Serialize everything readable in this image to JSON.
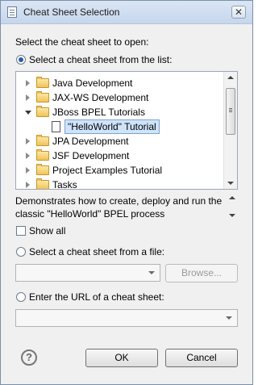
{
  "window": {
    "title": "Cheat Sheet Selection",
    "close_glyph": "✕"
  },
  "intro": "Select the cheat sheet to open:",
  "option_list": {
    "label": "Select a cheat sheet from the list:",
    "selected": true
  },
  "tree": {
    "items": [
      {
        "label": "Java Development",
        "expanded": false
      },
      {
        "label": "JAX-WS Development",
        "expanded": false
      },
      {
        "label": "JBoss BPEL Tutorials",
        "expanded": true
      },
      {
        "label": "\"HelloWorld\" Tutorial",
        "selected": true
      },
      {
        "label": "JPA Development",
        "expanded": false
      },
      {
        "label": "JSF Development",
        "expanded": false
      },
      {
        "label": "Project Examples Tutorial",
        "expanded": false
      },
      {
        "label": "Tasks",
        "expanded": false
      }
    ]
  },
  "description": "Demonstrates how to create, deploy and run the classic \"HelloWorld\" BPEL process",
  "show_all": {
    "label": "Show all",
    "checked": false
  },
  "option_file": {
    "label": "Select a cheat sheet from a file:",
    "selected": false,
    "browse_label": "Browse..."
  },
  "option_url": {
    "label": "Enter the URL of a cheat sheet:",
    "selected": false
  },
  "buttons": {
    "help_glyph": "?",
    "ok": "OK",
    "cancel": "Cancel"
  }
}
